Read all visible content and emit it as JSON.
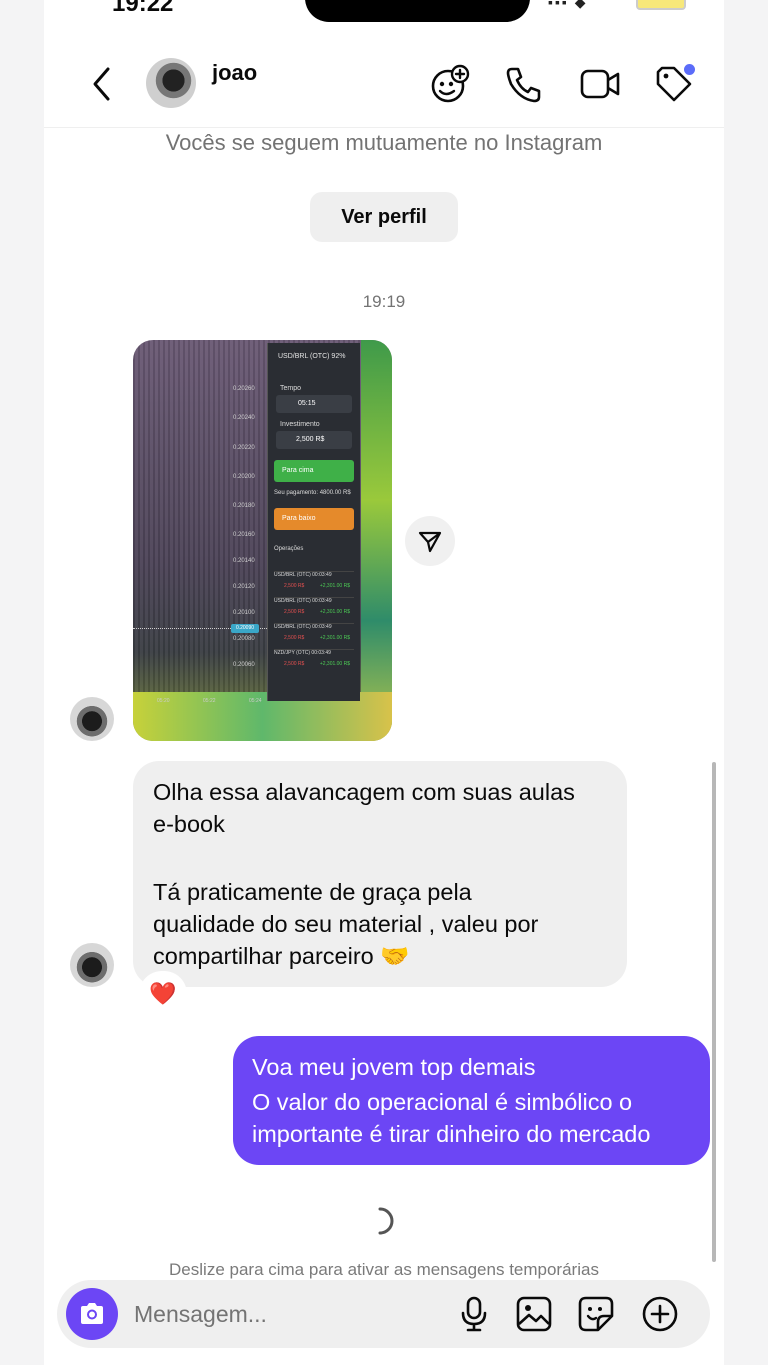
{
  "status_bar": {
    "time": "19:22"
  },
  "header": {
    "contact_name": "joao",
    "icons": [
      "back-chevron-icon",
      "effects-icon",
      "phone-icon",
      "video-icon",
      "tag-icon"
    ]
  },
  "follow_notice": "Vocês se seguem mutuamente no Instagram",
  "view_profile_label": "Ver perfil",
  "timestamp": "19:19",
  "shared_image": {
    "pair": "USD/BRL (OTC)",
    "payout_pct": "92%",
    "time_label": "Tempo",
    "time_value": "05:15",
    "investment_label": "Investimento",
    "investment_value": "2,500 R$",
    "buy_label": "Para cima",
    "sell_label": "Para baixo",
    "payout_text": "Seu pagamento: 4800.00 R$",
    "operations_label": "Operações",
    "prices": [
      "0.20260",
      "0.20240",
      "0.20220",
      "0.20200",
      "0.20180",
      "0.20160",
      "0.20140",
      "0.20120",
      "0.20100",
      "0.20080",
      "0.20060"
    ],
    "current_price": "0.20090",
    "x_ticks": [
      "05:20",
      "05:22",
      "05:24"
    ],
    "operations": [
      {
        "pair": "USD/BRL (OTC)",
        "time": "00:03:49",
        "amount": "2,500 R$",
        "profit": "+2,301.00 R$"
      },
      {
        "pair": "USD/BRL (OTC)",
        "time": "00:03:49",
        "amount": "2,500 R$",
        "profit": "+2,301.00 R$"
      },
      {
        "pair": "USD/BRL (OTC)",
        "time": "00:03:49",
        "amount": "2,500 R$",
        "profit": "+2,301.00 R$"
      },
      {
        "pair": "NZD/JPY (OTC)",
        "time": "00:03:49",
        "amount": "2,500 R$",
        "profit": "+2,301.00 R$"
      }
    ]
  },
  "incoming_message": {
    "lines": [
      "Olha essa alavancagem com suas aulas",
      "e-book",
      "",
      "Tá praticamente de graça pela",
      "qualidade do seu material , valeu por",
      "compartilhar parceiro 🤝"
    ],
    "reaction": "❤️"
  },
  "outgoing_message": {
    "lines": [
      "Voa meu jovem top demais",
      "O valor do operacional  é simbólico o",
      "importante é tirar dinheiro do mercado"
    ]
  },
  "vanish_hint": "Deslize para cima para ativar as mensagens temporárias",
  "composer": {
    "placeholder": "Mensagem...",
    "icons": [
      "camera-icon",
      "microphone-icon",
      "gallery-icon",
      "sticker-icon",
      "plus-icon"
    ]
  },
  "colors": {
    "accent": "#6c46f5",
    "incoming_bubble": "#efefef",
    "muted_text": "#737373",
    "notification_dot": "#5b6cf9"
  }
}
